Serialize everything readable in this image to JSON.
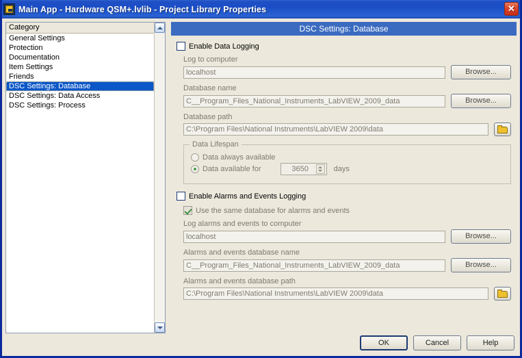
{
  "window": {
    "title": "Main App - Hardware QSM+.lvlib - Project Library Properties",
    "icon": "labview-library-icon",
    "close_label": "✕",
    "accent_blue": "#0a2a9c",
    "banner_blue": "#3a6bc0",
    "background": "#ece8dc"
  },
  "category": {
    "header": "Category",
    "items": [
      {
        "label": "General Settings",
        "selected": false
      },
      {
        "label": "Protection",
        "selected": false
      },
      {
        "label": "Documentation",
        "selected": false
      },
      {
        "label": "Item Settings",
        "selected": false
      },
      {
        "label": "Friends",
        "selected": false
      },
      {
        "label": "DSC Settings: Database",
        "selected": true
      },
      {
        "label": "DSC Settings: Data Access",
        "selected": false
      },
      {
        "label": "DSC Settings: Process",
        "selected": false
      }
    ],
    "scrollbar": {
      "up_icon": "chevron-up-icon",
      "down_icon": "chevron-down-icon"
    }
  },
  "panel": {
    "header": "DSC Settings: Database",
    "enable_data_logging": {
      "label": "Enable Data Logging",
      "checked": false
    },
    "log_to_computer": {
      "label": "Log to computer",
      "value": "localhost",
      "browse_label": "Browse..."
    },
    "database_name": {
      "label": "Database name",
      "value": "C__Program_Files_National_Instruments_LabVIEW_2009_data",
      "browse_label": "Browse..."
    },
    "database_path": {
      "label": "Database path",
      "value": "C:\\Program Files\\National Instruments\\LabVIEW 2009\\data",
      "browse_icon": "folder-icon"
    },
    "data_lifespan": {
      "title": "Data Lifespan",
      "option_always": "Data always available",
      "option_limited": "Data available for",
      "selected": "limited",
      "days_value": "3650",
      "days_units": "days"
    },
    "enable_alarms_logging": {
      "label": "Enable Alarms and Events Logging",
      "checked": false
    },
    "same_database": {
      "label": "Use the same database for alarms and events",
      "checked": true
    },
    "log_alarms_to_computer": {
      "label": "Log alarms and events to computer",
      "value": "localhost",
      "browse_label": "Browse..."
    },
    "alarms_database_name": {
      "label": "Alarms and events database name",
      "value": "C__Program_Files_National_Instruments_LabVIEW_2009_data",
      "browse_label": "Browse..."
    },
    "alarms_database_path": {
      "label": "Alarms and events database path",
      "value": "C:\\Program Files\\National Instruments\\LabVIEW 2009\\data",
      "browse_icon": "folder-icon"
    }
  },
  "footer": {
    "ok": "OK",
    "cancel": "Cancel",
    "help": "Help"
  }
}
